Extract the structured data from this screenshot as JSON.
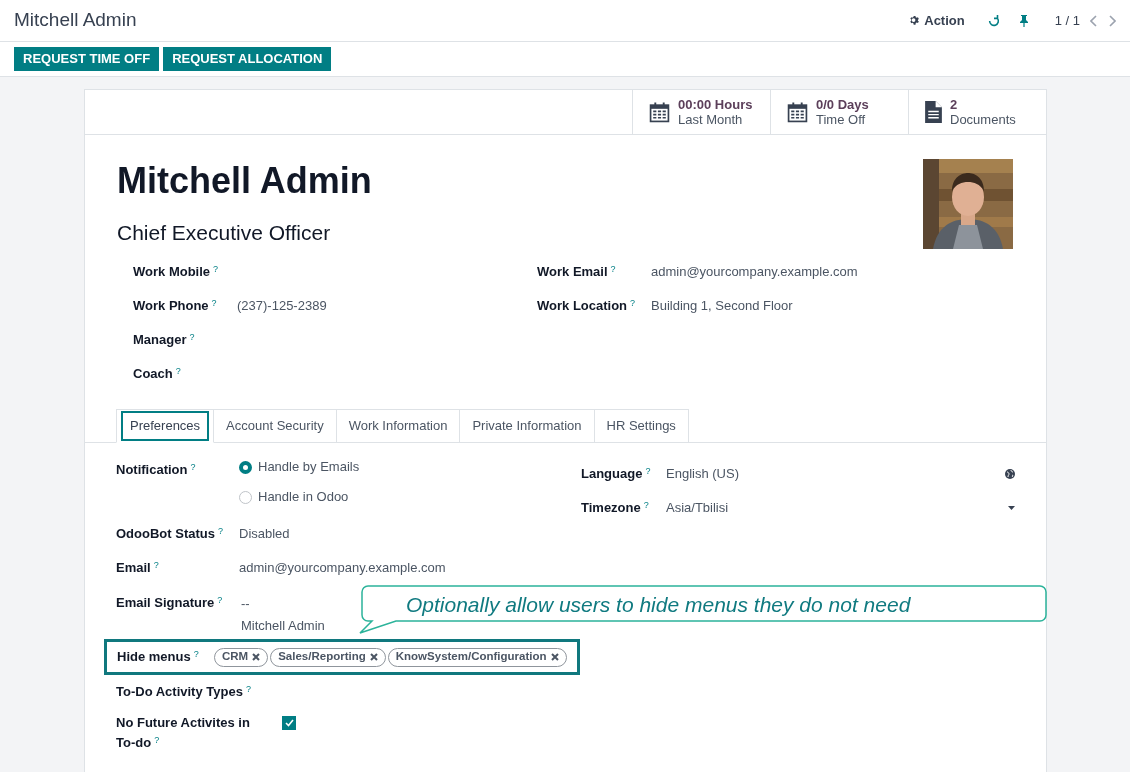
{
  "header": {
    "title": "Mitchell Admin",
    "action": "Action",
    "pager": "1 / 1"
  },
  "buttons": [
    "REQUEST TIME OFF",
    "REQUEST ALLOCATION"
  ],
  "stat_buttons": [
    {
      "kind": "calendar",
      "value": "00:00 Hours",
      "label": "Last Month"
    },
    {
      "kind": "calendar",
      "value": "0/0 Days",
      "label": "Time Off"
    },
    {
      "kind": "document",
      "value": "2",
      "label": "Documents"
    }
  ],
  "employee": {
    "name": "Mitchell Admin",
    "job_title": "Chief Executive Officer"
  },
  "fields_left": [
    {
      "label": "Work Mobile",
      "help": "?"
    },
    {
      "label": "Work Phone",
      "help": "?",
      "value": "(237)-125-2389"
    },
    {
      "label": "Manager",
      "help": "?"
    },
    {
      "label": "Coach",
      "help": "?"
    }
  ],
  "fields_right": [
    {
      "label": "Work Email",
      "help": "?",
      "value": "admin@yourcompany.example.com"
    },
    {
      "label": "Work Location",
      "help": "?",
      "value": "Building 1, Second Floor"
    }
  ],
  "tabs": [
    {
      "label": "Preferences",
      "selected": true
    },
    {
      "label": "Account Security",
      "selected": false
    },
    {
      "label": "Work Information",
      "selected": false
    },
    {
      "label": "Private Information",
      "selected": false
    },
    {
      "label": "HR Settings",
      "selected": false
    }
  ],
  "preferences_left": [
    {
      "kind": "radio",
      "label": "Notification",
      "help": "?",
      "options": [
        {
          "label": "Handle by Emails",
          "selected": true
        },
        {
          "label": "Handle in Odoo",
          "selected": false
        }
      ]
    },
    {
      "kind": "text",
      "label": "OdooBot Status",
      "help": "?",
      "value": "Disabled"
    },
    {
      "kind": "text",
      "label": "Email",
      "help": "?",
      "value": "admin@yourcompany.example.com"
    },
    {
      "kind": "signature",
      "label": "Email Signature",
      "help": "?",
      "lines": [
        "--",
        "Mitchell Admin"
      ]
    },
    {
      "kind": "tags",
      "label": "Hide menus",
      "help": "?",
      "tags": [
        "CRM",
        "Sales/Reporting",
        "KnowSystem/Configuration"
      ]
    },
    {
      "kind": "empty",
      "label": "To-Do Activity Types",
      "help": "?"
    },
    {
      "kind": "checkbox",
      "label": "No Future Activites in To-do",
      "help": "?",
      "checked": true
    }
  ],
  "preferences_right": [
    {
      "kind": "language",
      "label": "Language",
      "help": "?",
      "value": "English (US)"
    },
    {
      "kind": "select",
      "label": "Timezone",
      "help": "?",
      "value": "Asia/Tbilisi"
    }
  ],
  "callout": {
    "text": "Optionally allow users to hide menus they do not need"
  }
}
